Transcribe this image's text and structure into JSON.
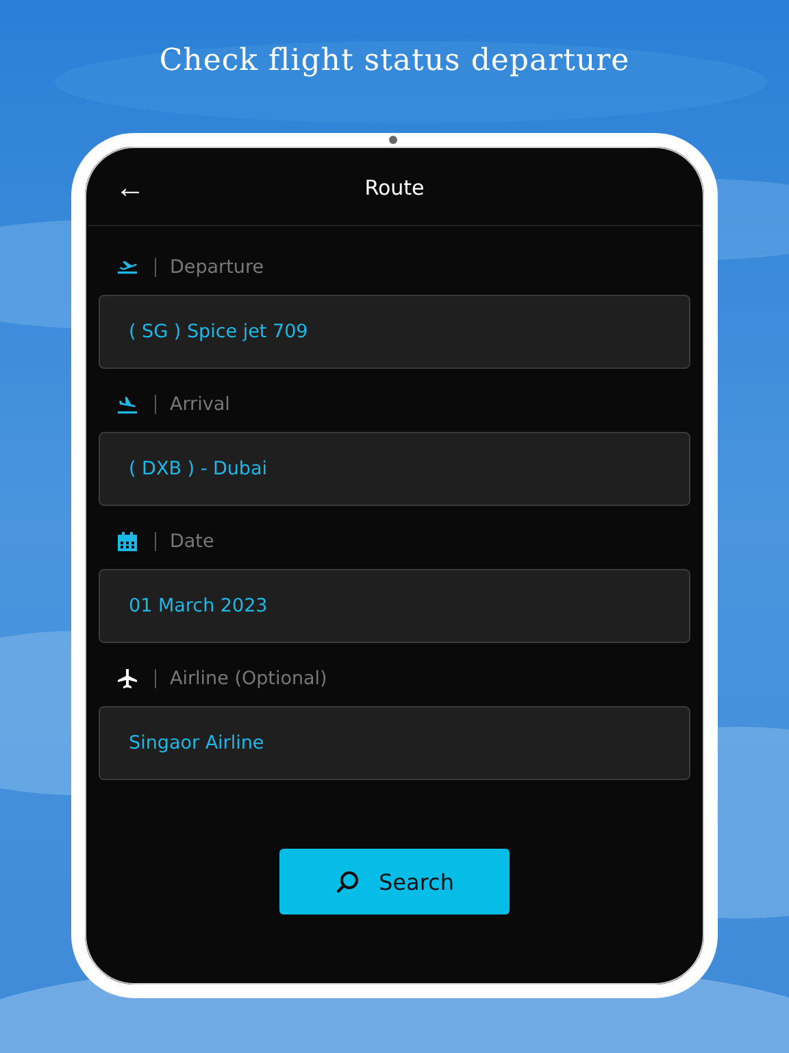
{
  "headline": "Check flight status departure",
  "screen": {
    "title": "Route",
    "back_icon": "←",
    "fields": [
      {
        "kind": "departure",
        "label": "Departure",
        "value": "( SG ) Spice jet 709"
      },
      {
        "kind": "arrival",
        "label": "Arrival",
        "value": "( DXB ) - Dubai"
      },
      {
        "kind": "date",
        "label": "Date",
        "value": "01 March 2023"
      },
      {
        "kind": "airline",
        "label": "Airline (Optional)",
        "value": "Singaor Airline"
      }
    ],
    "search_button": "Search"
  }
}
